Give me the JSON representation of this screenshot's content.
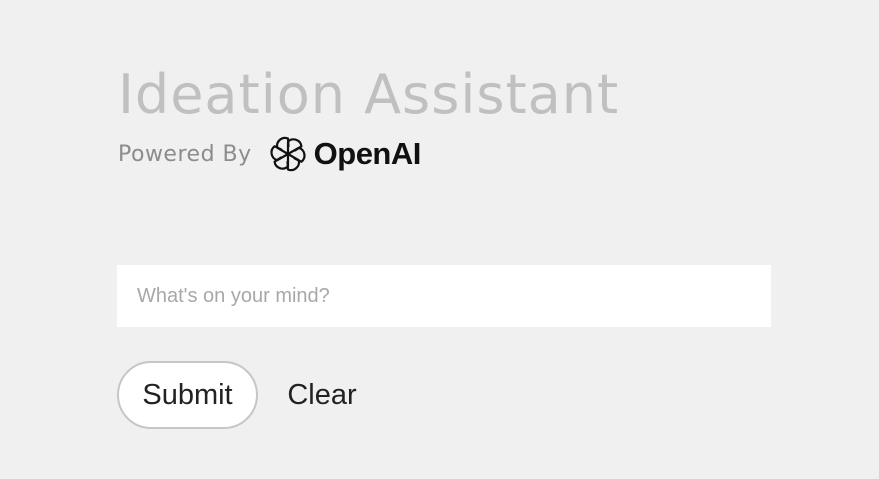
{
  "header": {
    "title": "Ideation Assistant",
    "powered_by": "Powered By",
    "brand": {
      "name": "OpenAI",
      "icon": "openai-logo-icon"
    }
  },
  "prompt": {
    "value": "",
    "placeholder": "What's on your mind?"
  },
  "actions": {
    "submit_label": "Submit",
    "clear_label": "Clear"
  },
  "colors": {
    "background": "#f0f0f0",
    "title": "#c0c0c0",
    "powered_by": "#8c8c8c",
    "brand": "#111111",
    "input_background": "#ffffff",
    "placeholder": "#a8a8a8",
    "button_border": "#c6c6c6",
    "button_text": "#222222"
  }
}
